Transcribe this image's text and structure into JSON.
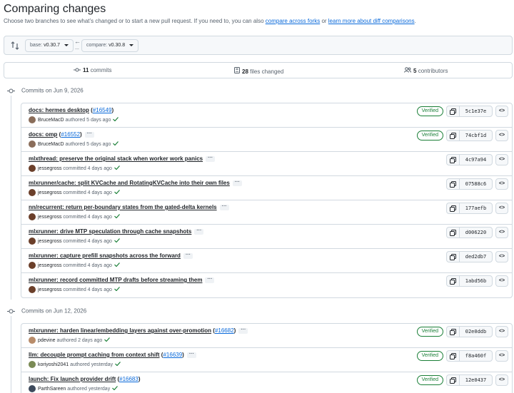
{
  "header": {
    "title": "Comparing changes",
    "subtitle_prefix": "Choose two branches to see what’s changed or to start a new pull request. If you need to, you can also ",
    "link_forks": "compare across forks",
    "subtitle_or": " or ",
    "link_learn": "learn more about diff comparisons",
    "subtitle_suffix": "."
  },
  "range": {
    "base_prefix": "base:",
    "base_value": "v0.30.7",
    "compare_prefix": "compare:",
    "compare_value": "v0.30.8",
    "arrow": "←",
    "dots": "..."
  },
  "stats": {
    "commits_count": "11",
    "commits_label": "commits",
    "files_count": "28",
    "files_label": "files changed",
    "contributors_count": "5",
    "contributors_label": "contributors"
  },
  "groups": [
    {
      "date": "Commits on Jun 9, 2026",
      "commits": [
        {
          "title": "docs: hermes desktop",
          "pr": "#16549",
          "author": "BruceMacD",
          "action": "authored 5 days ago",
          "verified": "Verified",
          "sha": "5c1e37e",
          "avatar_color": "#8a6d5a",
          "ellipsis": ""
        },
        {
          "title": "docs: omp",
          "pr": "#16552",
          "author": "BruceMacD",
          "action": "authored 5 days ago",
          "verified": "Verified",
          "sha": "74cbf1d",
          "avatar_color": "#8a6d5a",
          "ellipsis": "···"
        },
        {
          "title": "mlxthread: preserve the original stack when worker work panics",
          "pr": "",
          "author": "jessegross",
          "action": "committed 4 days ago",
          "verified": "",
          "sha": "4c97a94",
          "avatar_color": "#6b3f2a",
          "ellipsis": "···"
        },
        {
          "title": "mlxrunner/cache: split KVCache and RotatingKVCache into their own files",
          "pr": "",
          "author": "jessegross",
          "action": "committed 4 days ago",
          "verified": "",
          "sha": "07588c6",
          "avatar_color": "#6b3f2a",
          "ellipsis": "···"
        },
        {
          "title": "nn/recurrent: return per-boundary states from the gated-delta kernels",
          "pr": "",
          "author": "jessegross",
          "action": "committed 4 days ago",
          "verified": "",
          "sha": "177aefb",
          "avatar_color": "#6b3f2a",
          "ellipsis": "···"
        },
        {
          "title": "mlxrunner: drive MTP speculation through cache snapshots",
          "pr": "",
          "author": "jessegross",
          "action": "committed 4 days ago",
          "verified": "",
          "sha": "d006220",
          "avatar_color": "#6b3f2a",
          "ellipsis": "···"
        },
        {
          "title": "mlxrunner: capture prefill snapshots across the forward",
          "pr": "",
          "author": "jessegross",
          "action": "committed 4 days ago",
          "verified": "",
          "sha": "ded2db7",
          "avatar_color": "#6b3f2a",
          "ellipsis": "···"
        },
        {
          "title": "mlxrunner: record committed MTP drafts before streaming them",
          "pr": "",
          "author": "jessegross",
          "action": "committed 4 days ago",
          "verified": "",
          "sha": "1abd56b",
          "avatar_color": "#6b3f2a",
          "ellipsis": "···"
        }
      ]
    },
    {
      "date": "Commits on Jun 12, 2026",
      "commits": [
        {
          "title": "mlxrunner: harden linear/embedding layers against over-promotion",
          "pr": "#16682",
          "author": "pdevine",
          "action": "authored 2 days ago",
          "verified": "Verified",
          "sha": "02e0ddb",
          "avatar_color": "#b88c6a",
          "ellipsis": "···"
        },
        {
          "title": "llm: decouple prompt caching from context shift",
          "pr": "#16639",
          "author": "koriyoshi2041",
          "action": "authored yesterday",
          "verified": "Verified",
          "sha": "f8a460f",
          "avatar_color": "#7a8a55",
          "ellipsis": "···"
        },
        {
          "title": "launch: Fix launch provider drift",
          "pr": "#16683",
          "author": "ParthSareen",
          "action": "authored yesterday",
          "verified": "Verified",
          "sha": "12e0437",
          "avatar_color": "#3d4a5c",
          "ellipsis": ""
        }
      ]
    }
  ],
  "colors": {
    "link": "#0969da",
    "verified": "#1a7f37",
    "border": "#d1d9e0",
    "muted": "#59636e"
  },
  "icons": {
    "swap": "git-compare-icon",
    "commit": "git-commit-icon",
    "file": "file-diff-icon",
    "people": "people-icon",
    "copy": "copy-icon",
    "browse": "code-icon",
    "check": "check-icon"
  }
}
